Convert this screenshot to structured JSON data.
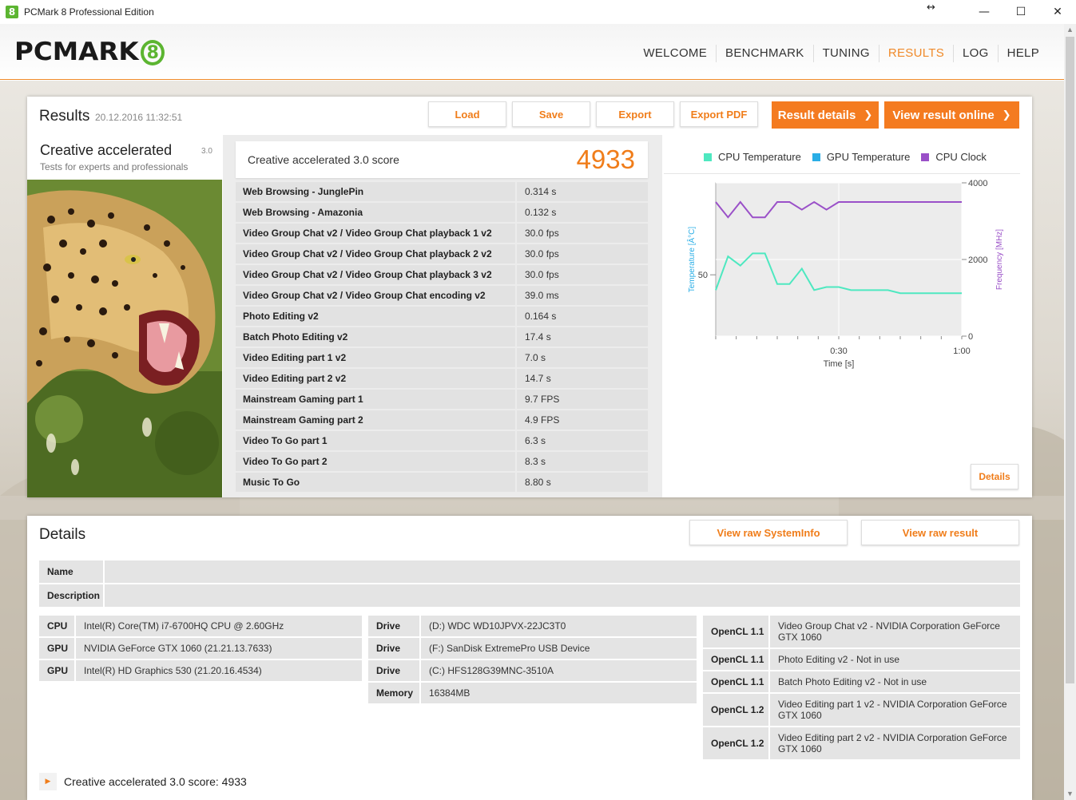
{
  "window": {
    "title": "PCMark 8 Professional Edition",
    "minimize": "—",
    "maximize": "☐",
    "close": "✕",
    "resize": "↔"
  },
  "header": {
    "logo_text": "PCMARK",
    "logo_mark": "8",
    "nav": [
      "WELCOME",
      "BENCHMARK",
      "TUNING",
      "RESULTS",
      "LOG",
      "HELP"
    ],
    "active_nav": "RESULTS"
  },
  "results": {
    "title": "Results",
    "timestamp": "20.12.2016 11:32:51",
    "buttons": {
      "load": "Load",
      "save": "Save",
      "export": "Export",
      "export_pdf": "Export PDF",
      "result_details": "Result details",
      "view_online": "View result online",
      "chevron": "❯"
    },
    "test": {
      "name": "Creative accelerated",
      "version": "3.0",
      "description": "Tests for experts and professionals"
    },
    "score": {
      "label": "Creative accelerated 3.0 score",
      "value": "4933"
    },
    "subtests": [
      {
        "name": "Web Browsing - JunglePin",
        "value": "0.314 s"
      },
      {
        "name": "Web Browsing - Amazonia",
        "value": "0.132 s"
      },
      {
        "name": "Video Group Chat v2 / Video Group Chat playback 1 v2",
        "value": "30.0 fps"
      },
      {
        "name": "Video Group Chat v2 / Video Group Chat playback 2 v2",
        "value": "30.0 fps"
      },
      {
        "name": "Video Group Chat v2 / Video Group Chat playback 3 v2",
        "value": "30.0 fps"
      },
      {
        "name": "Video Group Chat v2 / Video Group Chat encoding v2",
        "value": "39.0 ms"
      },
      {
        "name": "Photo Editing v2",
        "value": "0.164 s"
      },
      {
        "name": "Batch Photo Editing v2",
        "value": "17.4 s"
      },
      {
        "name": "Video Editing part 1 v2",
        "value": "7.0 s"
      },
      {
        "name": "Video Editing part 2 v2",
        "value": "14.7 s"
      },
      {
        "name": "Mainstream Gaming part 1",
        "value": "9.7 FPS"
      },
      {
        "name": "Mainstream Gaming part 2",
        "value": "4.9 FPS"
      },
      {
        "name": "Video To Go part 1",
        "value": "6.3 s"
      },
      {
        "name": "Video To Go part 2",
        "value": "8.3 s"
      },
      {
        "name": "Music To Go",
        "value": "8.80 s"
      }
    ],
    "chart_details_button": "Details"
  },
  "chart_data": {
    "type": "line",
    "title": "",
    "legend": [
      "CPU Temperature",
      "GPU Temperature",
      "CPU Clock"
    ],
    "legend_placement": "top",
    "xlabel": "Time [s]",
    "ylabel": "Temperature [Â°C]",
    "y2label": "Frequency [MHz]",
    "x_ticks": [
      "0:30",
      "1:00"
    ],
    "xlim": [
      0,
      60
    ],
    "y_ticks": [
      "50"
    ],
    "ylim": [
      30,
      80
    ],
    "y2_ticks": [
      "4000",
      "2000",
      "0"
    ],
    "y2lim": [
      0,
      4000
    ],
    "grid": true,
    "colors": {
      "cpu_temp": "#4ee8c0",
      "gpu_temp": "#2aaee6",
      "cpu_clock": "#9a50c8"
    },
    "series": [
      {
        "name": "CPU Temperature",
        "axis": "left",
        "color": "#4ee8c0",
        "x": [
          0,
          3,
          6,
          9,
          12,
          15,
          18,
          21,
          24,
          27,
          30,
          33,
          36,
          39,
          42,
          45,
          48,
          51,
          54,
          57,
          60
        ],
        "y": [
          45,
          56,
          53,
          57,
          57,
          47,
          47,
          52,
          45,
          46,
          46,
          45,
          45,
          45,
          45,
          44,
          44,
          44,
          44,
          44,
          44
        ]
      },
      {
        "name": "CPU Clock",
        "axis": "right",
        "color": "#9a50c8",
        "x": [
          0,
          3,
          6,
          9,
          12,
          15,
          18,
          21,
          24,
          27,
          30,
          33,
          36,
          39,
          42,
          45,
          48,
          51,
          54,
          57,
          60
        ],
        "y": [
          3500,
          3100,
          3500,
          3100,
          3100,
          3500,
          3500,
          3300,
          3500,
          3300,
          3500,
          3500,
          3500,
          3500,
          3500,
          3500,
          3500,
          3500,
          3500,
          3500,
          3500
        ]
      }
    ]
  },
  "details": {
    "title": "Details",
    "buttons": {
      "raw_sysinfo": "View raw SystemInfo",
      "raw_result": "View raw result"
    },
    "name_label": "Name",
    "name_value": "",
    "description_label": "Description",
    "description_value": "",
    "hardware": [
      {
        "key": "CPU",
        "value": "Intel(R) Core(TM) i7-6700HQ CPU @ 2.60GHz"
      },
      {
        "key": "GPU",
        "value": "NVIDIA GeForce GTX 1060 (21.21.13.7633)"
      },
      {
        "key": "GPU",
        "value": "Intel(R) HD Graphics 530 (21.20.16.4534)"
      }
    ],
    "drives": [
      {
        "key": "Drive",
        "value": "(D:) WDC WD10JPVX-22JC3T0"
      },
      {
        "key": "Drive",
        "value": "(F:) SanDisk ExtremePro USB Device"
      },
      {
        "key": "Drive",
        "value": "(C:) HFS128G39MNC-3510A"
      },
      {
        "key": "Memory",
        "value": "16384MB"
      }
    ],
    "opencl": [
      {
        "key": "OpenCL 1.1",
        "value": "Video Group Chat v2 - NVIDIA Corporation GeForce GTX 1060"
      },
      {
        "key": "OpenCL 1.1",
        "value": "Photo Editing v2 - Not in use"
      },
      {
        "key": "OpenCL 1.1",
        "value": "Batch Photo Editing v2 - Not in use"
      },
      {
        "key": "OpenCL 1.2",
        "value": "Video Editing part 1 v2 - NVIDIA Corporation GeForce GTX 1060"
      },
      {
        "key": "OpenCL 1.2",
        "value": "Video Editing part 2 v2 - NVIDIA Corporation GeForce GTX 1060"
      }
    ],
    "expand_arrow": "▶",
    "summary": "Creative accelerated 3.0 score: 4933"
  }
}
